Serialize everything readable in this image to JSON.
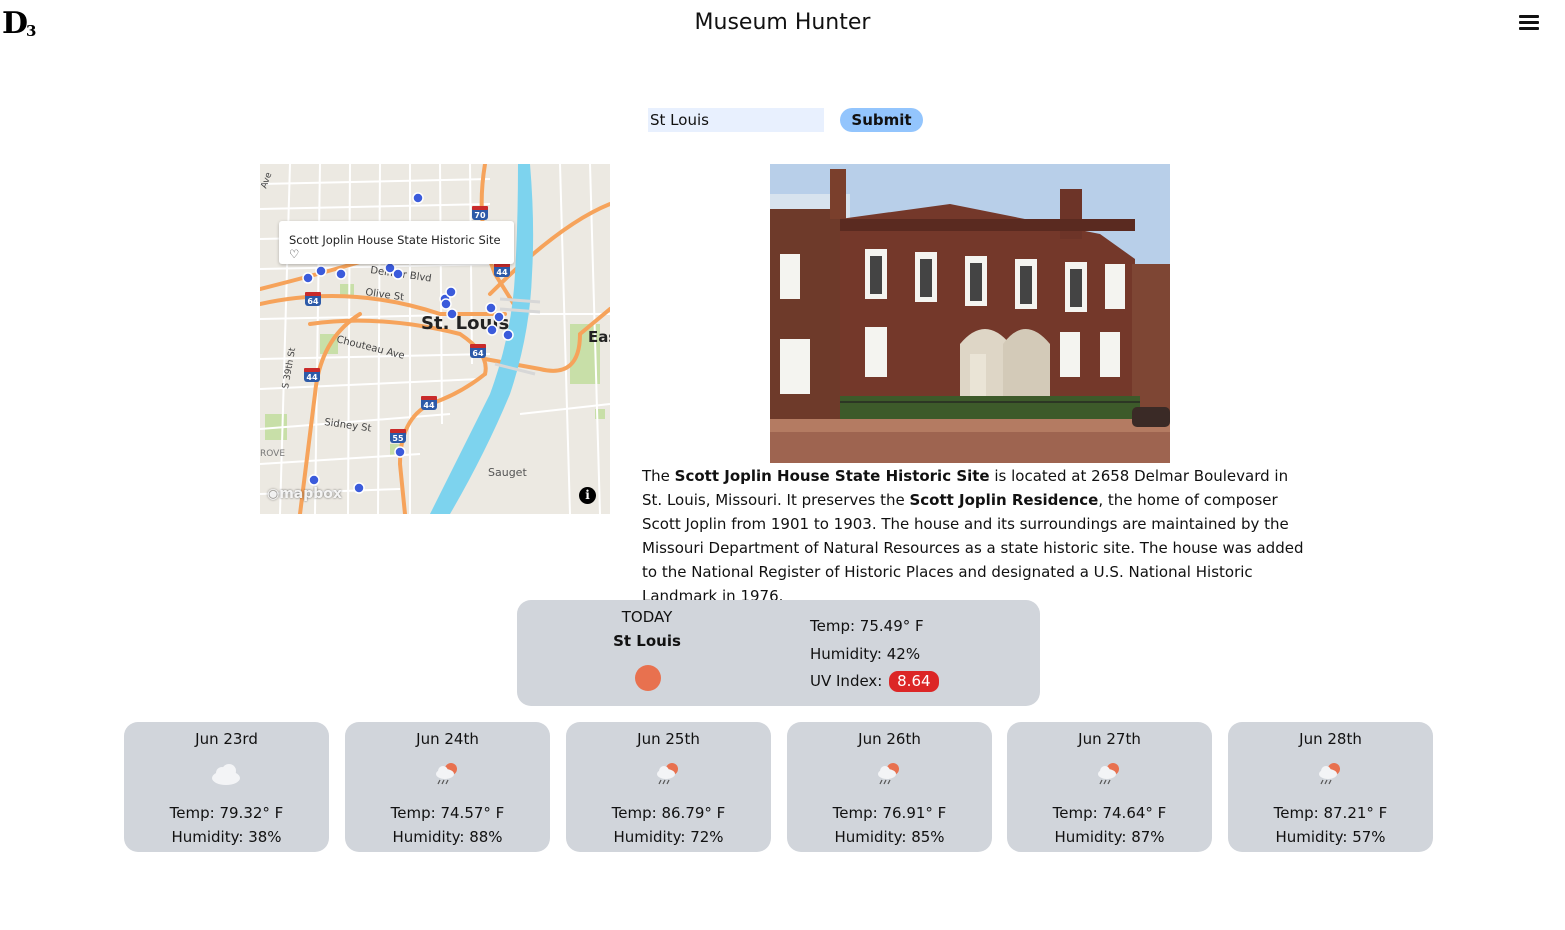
{
  "header": {
    "logo_text": "D",
    "logo_sub": "3",
    "title": "Museum Hunter",
    "menu_icon": "hamburger-menu-icon"
  },
  "search": {
    "value": "St Louis",
    "submit_label": "Submit"
  },
  "map": {
    "popup_text": "Scott Joplin House State Historic Site ♡",
    "attribution": "mapbox",
    "info_icon": "i",
    "labels": {
      "city": "St. Louis",
      "olive": "Olive St",
      "delmar": "Delmar Blvd",
      "chouteau": "Chouteau Ave",
      "sidney": "Sidney St",
      "sauget": "Sauget",
      "s39": "S 39th St",
      "east": "Eas",
      "rove": "ROVE",
      "ave": "Ave"
    },
    "highway_shields": [
      "70",
      "64",
      "44",
      "64",
      "44",
      "44",
      "55",
      "64"
    ],
    "accent_colors": {
      "marker": "#3b5bdb",
      "river": "#7dd3ee",
      "highway": "#f6a35b"
    }
  },
  "museum": {
    "name": "Scott Joplin House State Historic Site",
    "description_part1": "The ",
    "description_part2": " is located at 2658 Delmar Boulevard in St. Louis, Missouri. It preserves the ",
    "residence": "Scott Joplin Residence",
    "description_part3": ", the home of composer Scott Joplin from 1901 to 1903. The house and its surroundings are maintained by the Missouri Department of Natural Resources as a state historic site. The house was added to the National Register of Historic Places and designated a U.S. National Historic Landmark in 1976."
  },
  "today": {
    "label": "TODAY",
    "city": "St Louis",
    "icon": "sun-icon",
    "temp": "Temp: 75.49° F",
    "humidity": "Humidity: 42%",
    "uv_label": "UV Index:",
    "uv_value": "8.64"
  },
  "forecast": [
    {
      "date": "Jun 23rd",
      "icon": "cloud-icon",
      "temp": "Temp: 79.32° F",
      "humidity": "Humidity: 38%"
    },
    {
      "date": "Jun 24th",
      "icon": "rain-sun-icon",
      "temp": "Temp: 74.57° F",
      "humidity": "Humidity: 88%"
    },
    {
      "date": "Jun 25th",
      "icon": "rain-sun-icon",
      "temp": "Temp: 86.79° F",
      "humidity": "Humidity: 72%"
    },
    {
      "date": "Jun 26th",
      "icon": "rain-sun-icon",
      "temp": "Temp: 76.91° F",
      "humidity": "Humidity: 85%"
    },
    {
      "date": "Jun 27th",
      "icon": "rain-sun-icon",
      "temp": "Temp: 74.64° F",
      "humidity": "Humidity: 87%"
    },
    {
      "date": "Jun 28th",
      "icon": "rain-sun-icon",
      "temp": "Temp: 87.21° F",
      "humidity": "Humidity: 57%"
    }
  ]
}
